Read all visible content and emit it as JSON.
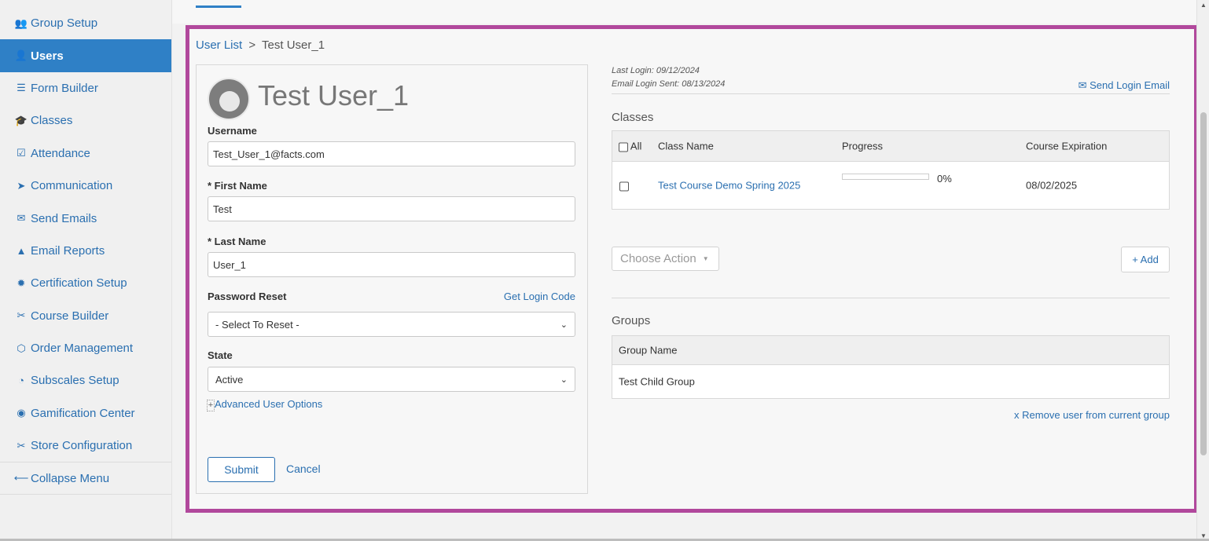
{
  "sidebar": {
    "items": [
      {
        "label": "Group Setup",
        "icon": "users-icon",
        "glyph": "👥",
        "active": false
      },
      {
        "label": "Users",
        "icon": "user-icon",
        "glyph": "👤",
        "active": true
      },
      {
        "label": "Form Builder",
        "icon": "list-icon",
        "glyph": "☰",
        "active": false
      },
      {
        "label": "Classes",
        "icon": "graduation-cap-icon",
        "glyph": "🎓",
        "active": false
      },
      {
        "label": "Attendance",
        "icon": "checkbox-icon",
        "glyph": "☑",
        "active": false
      },
      {
        "label": "Communication",
        "icon": "paper-plane-icon",
        "glyph": "➤",
        "active": false
      },
      {
        "label": "Send Emails",
        "icon": "envelope-icon",
        "glyph": "✉",
        "active": false
      },
      {
        "label": "Email Reports",
        "icon": "chart-icon",
        "glyph": "▲",
        "active": false
      },
      {
        "label": "Certification Setup",
        "icon": "badge-icon",
        "glyph": "✹",
        "active": false
      },
      {
        "label": "Course Builder",
        "icon": "tools-icon",
        "glyph": "✂",
        "active": false
      },
      {
        "label": "Order Management",
        "icon": "box-icon",
        "glyph": "⬡",
        "active": false
      },
      {
        "label": "Subscales Setup",
        "icon": "gauge-icon",
        "glyph": "◔",
        "active": false
      },
      {
        "label": "Gamification Center",
        "icon": "gamepad-icon",
        "glyph": "◉",
        "active": false
      },
      {
        "label": "Store Configuration",
        "icon": "tools-icon",
        "glyph": "✂",
        "active": false
      }
    ],
    "collapse_label": "Collapse Menu",
    "collapse_glyph": "⟵"
  },
  "breadcrumb": {
    "parent": "User List",
    "separator": ">",
    "current": "Test User_1"
  },
  "user": {
    "display_name": "Test User_1",
    "username_label": "Username",
    "username": "Test_User_1@facts.com",
    "first_name_label": "* First Name",
    "first_name": "Test",
    "last_name_label": "* Last Name",
    "last_name": "User_1",
    "password_reset_label": "Password Reset",
    "get_login_code": "Get Login Code",
    "password_reset_value": "- Select To Reset -",
    "state_label": "State",
    "state_value": "Active",
    "advanced_plus": "+",
    "advanced_label": "Advanced User Options",
    "submit": "Submit",
    "cancel": "Cancel"
  },
  "login_info": {
    "last_login": "Last Login: 09/12/2024",
    "email_login_sent": "Email Login Sent: 08/13/2024",
    "send_login_email": "Send Login Email"
  },
  "classes": {
    "title": "Classes",
    "headers": {
      "all": "All",
      "class_name": "Class Name",
      "progress": "Progress",
      "expiration": "Course Expiration"
    },
    "rows": [
      {
        "name": "Test Course Demo Spring 2025",
        "progress_pct": 0,
        "progress_label": "0%",
        "expiration": "08/02/2025"
      }
    ],
    "choose_action": "Choose Action",
    "add": "+ Add"
  },
  "groups": {
    "title": "Groups",
    "header": "Group Name",
    "rows": [
      "Test Child Group"
    ],
    "remove_link": "x Remove user from current group"
  },
  "colors": {
    "accent": "#2f80c6",
    "link": "#2a6fb0",
    "highlight_border": "#b1489c"
  }
}
